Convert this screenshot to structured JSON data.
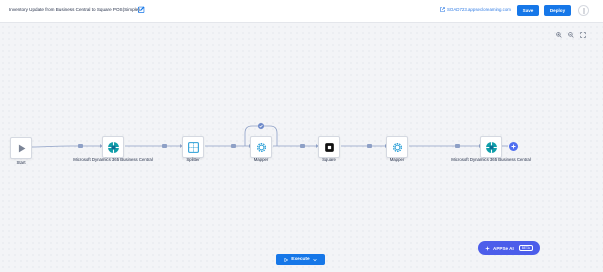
{
  "header": {
    "title": "Inventory Update from Business Central to Square POS(Simple)",
    "url": "SOAD723.appsecloreaming.com",
    "save_label": "Save",
    "deploy_label": "Deploy"
  },
  "flow": {
    "nodes": [
      {
        "label": "Start",
        "icon": "play-icon"
      },
      {
        "label": "Microsoft Dynamics 365 Business Central",
        "icon": "dynamics-365-icon"
      },
      {
        "label": "Splitter",
        "icon": "splitter-icon"
      },
      {
        "label": "Mapper",
        "icon": "gear-icon"
      },
      {
        "label": "Square",
        "icon": "square-icon"
      },
      {
        "label": "Mapper",
        "icon": "gear-icon"
      },
      {
        "label": "Microsoft Dynamics 365 Business Central",
        "icon": "dynamics-365-icon"
      }
    ]
  },
  "ai": {
    "label": "APPSe AI",
    "badge": "BETA"
  },
  "execute": {
    "label": "Execute"
  },
  "colors": {
    "primary": "#1677e8",
    "ai": "#4c5dea",
    "edge": "#8ea0c6",
    "teal": "#0f9ea9"
  }
}
